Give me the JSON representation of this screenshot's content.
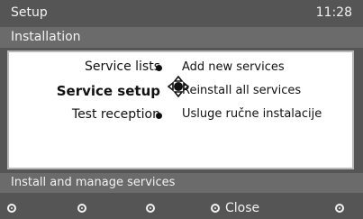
{
  "header": {
    "title": "Setup",
    "time": "11:28"
  },
  "subheader": {
    "section": "Installation"
  },
  "menu": {
    "left": [
      {
        "label": "Service lists",
        "selected": false
      },
      {
        "label": "Service setup",
        "selected": true
      },
      {
        "label": "Test reception",
        "selected": false
      }
    ],
    "right": [
      "Add new services",
      "Reinstall all services",
      "Usluge ručne instalacije"
    ]
  },
  "hint": "Install and manage services",
  "colorkeys": {
    "close_label": "Close"
  }
}
